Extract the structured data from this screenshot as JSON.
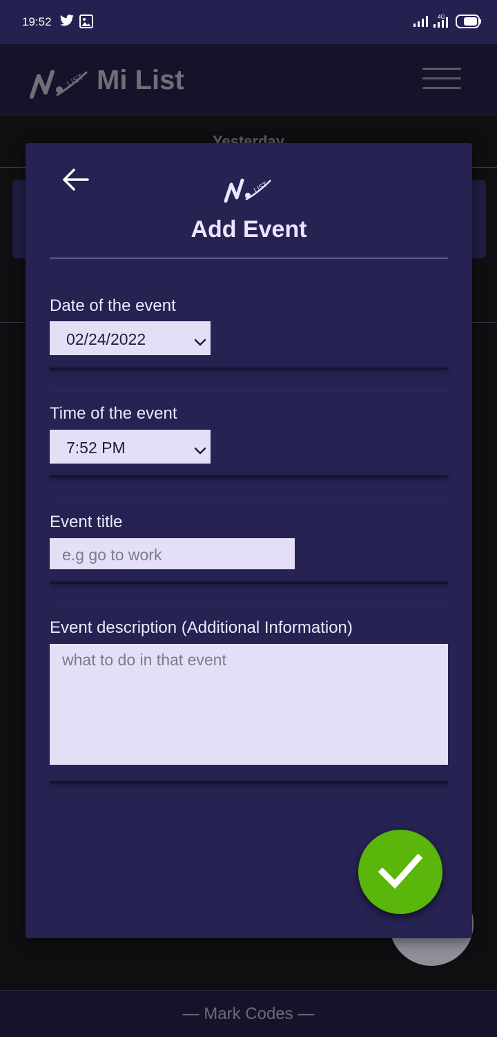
{
  "statusbar": {
    "time": "19:52"
  },
  "appbar": {
    "title": "Mi List"
  },
  "background": {
    "day_header": "Yesterday"
  },
  "modal": {
    "title": "Add Event",
    "date": {
      "label": "Date of the event",
      "value": "02/24/2022"
    },
    "time": {
      "label": "Time of the event",
      "value": "7:52 PM"
    },
    "event_title": {
      "label": "Event title",
      "placeholder": "e.g go to work"
    },
    "description": {
      "label": "Event description (Additional Information)",
      "placeholder": "what to do in that event"
    }
  },
  "footer": {
    "text": "— Mark Codes —"
  },
  "colors": {
    "accent": "#262252",
    "confirm": "#5ab60a",
    "field_bg": "#e4dff7"
  }
}
